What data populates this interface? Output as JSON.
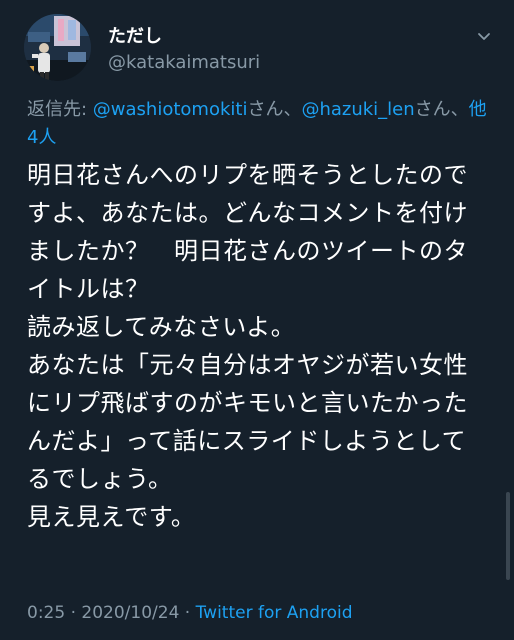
{
  "author": {
    "display_name": "ただし",
    "handle": "@katakaimatsuri"
  },
  "reply_to": {
    "prefix": "返信先: ",
    "mention_1": "@washiotomokiti",
    "joiner_1": "さん、",
    "mention_2": "@hazuki_len",
    "joiner_2": "さん、",
    "others": "他4人"
  },
  "tweet_text": "明日花さんへのリプを晒そうとしたのですよ、あなたは。どんなコメントを付けましたか？　明日花さんのツイートのタイトルは？\n読み返してみなさいよ。\nあなたは「元々自分はオヤジが若い女性にリプ飛ばすのがキモいと言いたかったんだよ」って話にスライドしようとしてるでしょう。\n見え見えです。",
  "meta": {
    "time": "0:25",
    "separator_1": " · ",
    "date": "2020/10/24",
    "separator_2": " · ",
    "source": "Twitter for Android"
  },
  "icons": {
    "menu": "chevron-down-icon"
  },
  "colors": {
    "background": "#15202b",
    "text": "#ffffff",
    "muted": "#8899a6",
    "link": "#1da1f2"
  }
}
